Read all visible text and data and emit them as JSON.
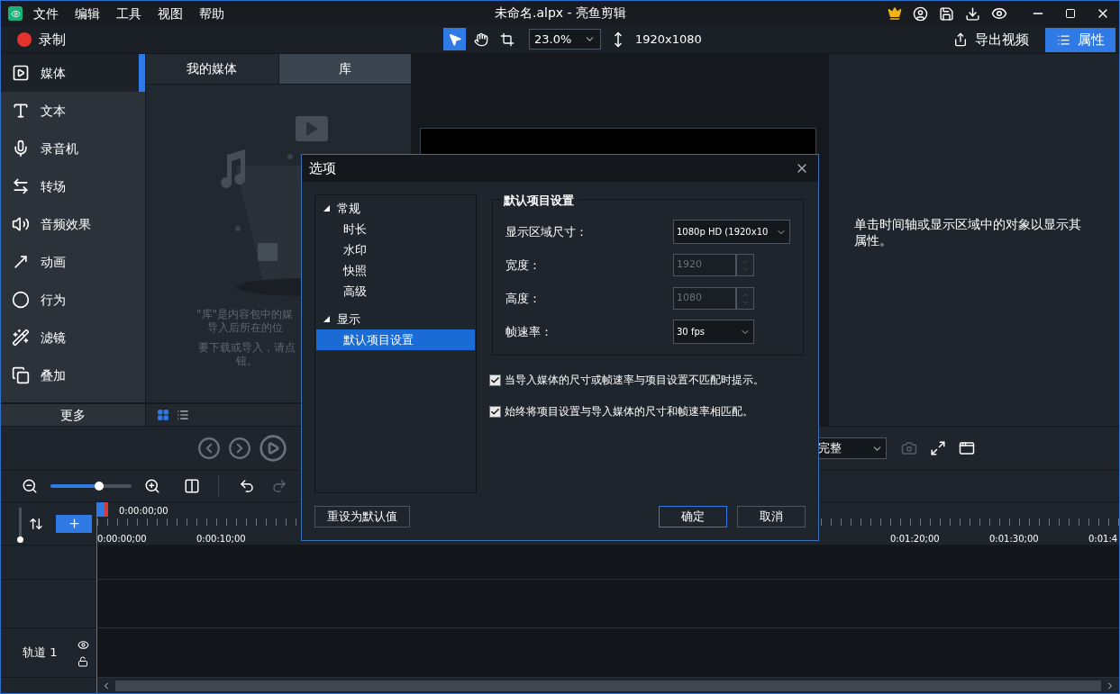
{
  "window": {
    "menu": [
      "文件",
      "编辑",
      "工具",
      "视图",
      "帮助"
    ],
    "title": "未命名.alpx - 亮鱼剪辑"
  },
  "toolbar": {
    "record": "录制",
    "tools": [
      {
        "kind": "pointer",
        "selected": true
      },
      {
        "kind": "hand",
        "selected": false
      },
      {
        "kind": "crop",
        "selected": false
      }
    ],
    "zoom": "23.0%",
    "size": "1920x1080",
    "export": "导出视频",
    "properties": "属性"
  },
  "sidebar": {
    "items": [
      {
        "kind": "media",
        "label": "媒体",
        "selected": true
      },
      {
        "kind": "text",
        "label": "文本",
        "selected": false
      },
      {
        "kind": "mic",
        "label": "录音机",
        "selected": false
      },
      {
        "kind": "transition",
        "label": "转场",
        "selected": false
      },
      {
        "kind": "audio",
        "label": "音频效果",
        "selected": false
      },
      {
        "kind": "animation",
        "label": "动画",
        "selected": false
      },
      {
        "kind": "behavior",
        "label": "行为",
        "selected": false
      },
      {
        "kind": "filter",
        "label": "滤镜",
        "selected": false
      },
      {
        "kind": "overlay",
        "label": "叠加",
        "selected": false
      }
    ],
    "more": "更多"
  },
  "media": {
    "tabs": [
      {
        "label": "我的媒体",
        "selected": false
      },
      {
        "label": "库",
        "selected": true
      }
    ],
    "hint_lines": [
      "\"库\"是内容包中的媒",
      "导入后所在的位"
    ],
    "hint_lines_2": [
      "要下载或导入，请点",
      "钮。"
    ],
    "view_modes": [
      {
        "kind": "grid",
        "selected": true
      },
      {
        "kind": "list",
        "selected": false
      }
    ]
  },
  "properties": {
    "hint": "单击时间轴或显示区域中的对象以显示其属性。"
  },
  "player": {
    "quality": "完整"
  },
  "timeline": {
    "zoom": {
      "level": 0.6
    },
    "track_height": {
      "level": 0
    },
    "playhead": "0:00:00;00",
    "ruler_left": [
      "0:00:00;00",
      "0:00:10;00"
    ],
    "ruler_right": [
      "0:01:20;00",
      "0:01:30;00",
      "0:01:4"
    ],
    "tracks": [
      {
        "name": "轨道 1"
      }
    ]
  },
  "dialog": {
    "title": "选项",
    "tree": [
      {
        "label": "常规",
        "expanded": true,
        "selected": false,
        "children": [
          {
            "label": "时长",
            "selected": false
          },
          {
            "label": "水印",
            "selected": false
          },
          {
            "label": "快照",
            "selected": false
          },
          {
            "label": "高级",
            "selected": false
          }
        ]
      },
      {
        "label": "显示",
        "expanded": true,
        "selected": false,
        "children": [
          {
            "label": "默认项目设置",
            "selected": true
          }
        ]
      }
    ],
    "group_title": "默认项目设置",
    "fields": [
      {
        "kind": "select",
        "label": "显示区域尺寸：",
        "value": "1080p HD (1920x10",
        "disabled": false
      },
      {
        "kind": "spin",
        "label": "宽度：",
        "value": "1920",
        "disabled": true
      },
      {
        "kind": "spin",
        "label": "高度：",
        "value": "1080",
        "disabled": true
      },
      {
        "kind": "select",
        "label": "帧速率：",
        "value": "30 fps",
        "disabled": false
      }
    ],
    "checks": [
      {
        "label": "当导入媒体的尺寸或帧速率与项目设置不匹配时提示。",
        "checked": true
      },
      {
        "label": "始终将项目设置与导入媒体的尺寸和帧速率相匹配。",
        "checked": true
      }
    ],
    "reset": "重设为默认值",
    "ok": "确定",
    "cancel": "取消"
  }
}
